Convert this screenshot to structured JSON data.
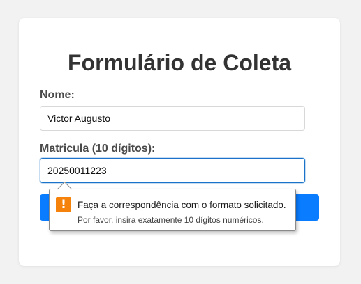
{
  "form": {
    "title": "Formulário de Coleta",
    "name_label": "Nome:",
    "name_value": "Victor Augusto",
    "matricula_label": "Matricula (10 dígitos):",
    "matricula_value": "20250011223",
    "submit_label": ""
  },
  "validation_tooltip": {
    "icon": "warning-icon",
    "message": "Faça a correspondência com o formato solicitado.",
    "hint": "Por favor, insira exatamente 10 dígitos numéricos."
  },
  "colors": {
    "background": "#f2f2f2",
    "submit_button": "#0a7cff",
    "focus_border": "#1a73c9",
    "warning": "#f5820b"
  }
}
